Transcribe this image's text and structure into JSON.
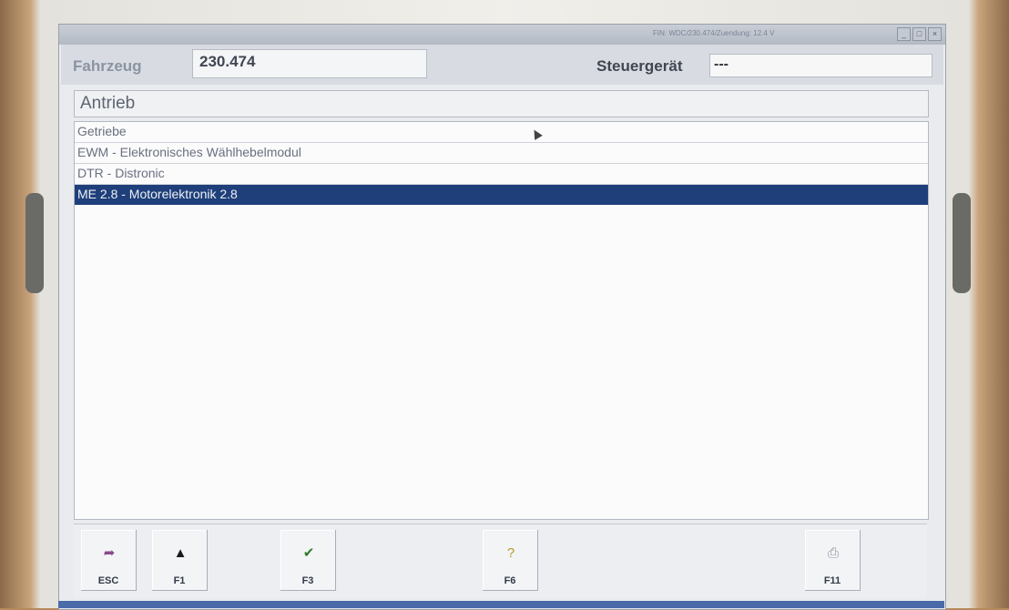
{
  "window": {
    "app_title": "",
    "title_info": "FIN: WDC/230.474/Zuendung: 12.4 V"
  },
  "vehicle": {
    "fahrzeug_label": "Fahrzeug",
    "fahrzeug_value": "230.474",
    "steuergeraet_label": "Steuergerät",
    "steuergeraet_value": "---"
  },
  "group": {
    "title": "Antrieb"
  },
  "list": {
    "items": [
      {
        "label": "Getriebe",
        "selected": false
      },
      {
        "label": "EWM - Elektronisches Wählhebelmodul",
        "selected": false
      },
      {
        "label": "DTR - Distronic",
        "selected": false
      },
      {
        "label": "ME 2.8 - Motorelektronik 2.8",
        "selected": true
      }
    ]
  },
  "function_keys": [
    {
      "label": "ESC",
      "icon": "exit-icon",
      "color": "#8a4a8a"
    },
    {
      "label": "F1",
      "icon": "arrow-up-icon",
      "color": "#1a1a1a"
    },
    {
      "label": "F3",
      "icon": "checkmark-icon",
      "color": "#2f7a2f"
    },
    {
      "label": "F6",
      "icon": "help-icon",
      "color": "#b79a2a"
    },
    {
      "label": "F11",
      "icon": "print-icon",
      "color": "#8c93a0"
    }
  ],
  "colors": {
    "selection": "#1e3f7a",
    "label_text": "#404652"
  }
}
